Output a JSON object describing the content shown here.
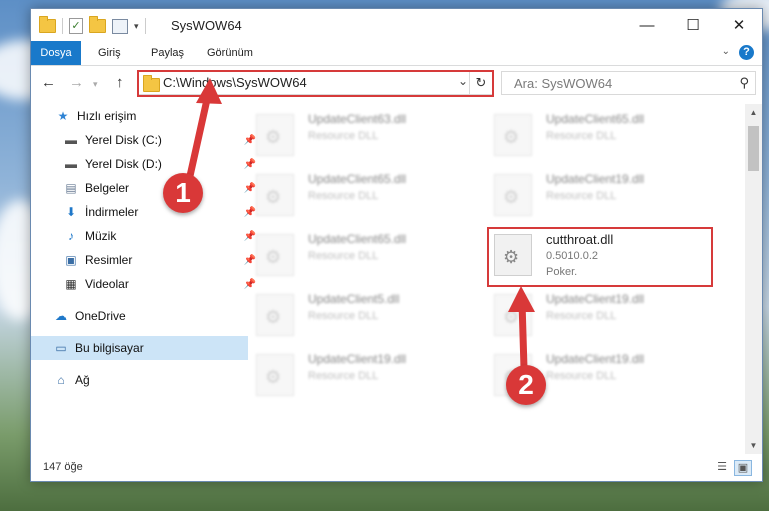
{
  "window": {
    "title": "SysWOW64",
    "controls": {
      "minimize": "—",
      "maximize": "☐",
      "close": "✕"
    }
  },
  "ribbon": {
    "tabs": [
      "Dosya",
      "Giriş",
      "Paylaş",
      "Görünüm"
    ],
    "help": "?"
  },
  "address_bar": {
    "path": "C:\\Windows\\SysWOW64"
  },
  "search": {
    "placeholder": "Ara: SysWOW64"
  },
  "sidebar": {
    "items": [
      {
        "label": "Hızlı erişim",
        "icon": "star-icon",
        "pinned": false
      },
      {
        "label": "Yerel Disk (C:)",
        "icon": "drive-icon",
        "pinned": true
      },
      {
        "label": "Yerel Disk (D:)",
        "icon": "drive-icon",
        "pinned": true
      },
      {
        "label": "Belgeler",
        "icon": "documents-icon",
        "pinned": true
      },
      {
        "label": "İndirmeler",
        "icon": "download-icon",
        "pinned": true
      },
      {
        "label": "Müzik",
        "icon": "music-icon",
        "pinned": true
      },
      {
        "label": "Resimler",
        "icon": "pictures-icon",
        "pinned": true
      },
      {
        "label": "Videolar",
        "icon": "videos-icon",
        "pinned": true
      },
      {
        "label": "OneDrive",
        "icon": "cloud-icon",
        "pinned": false
      },
      {
        "label": "Bu bilgisayar",
        "icon": "computer-icon",
        "pinned": false,
        "selected": true
      },
      {
        "label": "Ağ",
        "icon": "network-icon",
        "pinned": false
      }
    ]
  },
  "files": [
    {
      "name": "UpdateClient63.dll",
      "desc": "Resource DLL",
      "faded": true
    },
    {
      "name": "UpdateClient65.dll",
      "desc": "Resource DLL",
      "faded": true
    },
    {
      "name": "UpdateClient65.dll",
      "desc": "Resource DLL",
      "faded": true
    },
    {
      "name": "UpdateClient19.dll",
      "desc": "Resource DLL",
      "faded": true
    },
    {
      "name": "UpdateClient65.dll",
      "desc": "Resource DLL",
      "faded": true
    },
    {
      "name": "cutthroat.dll",
      "version": "0.5010.0.2",
      "desc": "Poker.",
      "faded": false,
      "highlighted": true
    },
    {
      "name": "UpdateClient5.dll",
      "desc": "Resource DLL",
      "faded": true
    },
    {
      "name": "UpdateClient19.dll",
      "desc": "Resource DLL",
      "faded": true
    },
    {
      "name": "UpdateClient19.dll",
      "desc": "Resource DLL",
      "faded": true
    },
    {
      "name": "UpdateClient19.dll",
      "desc": "Resource DLL",
      "faded": true
    }
  ],
  "status": {
    "item_count": "147 öğe"
  },
  "annotations": {
    "callout1": "1",
    "callout2": "2",
    "color": "#d93838"
  },
  "colors": {
    "accent": "#1979ca",
    "selection": "#cce4f7",
    "highlight": "#d63a3a"
  }
}
